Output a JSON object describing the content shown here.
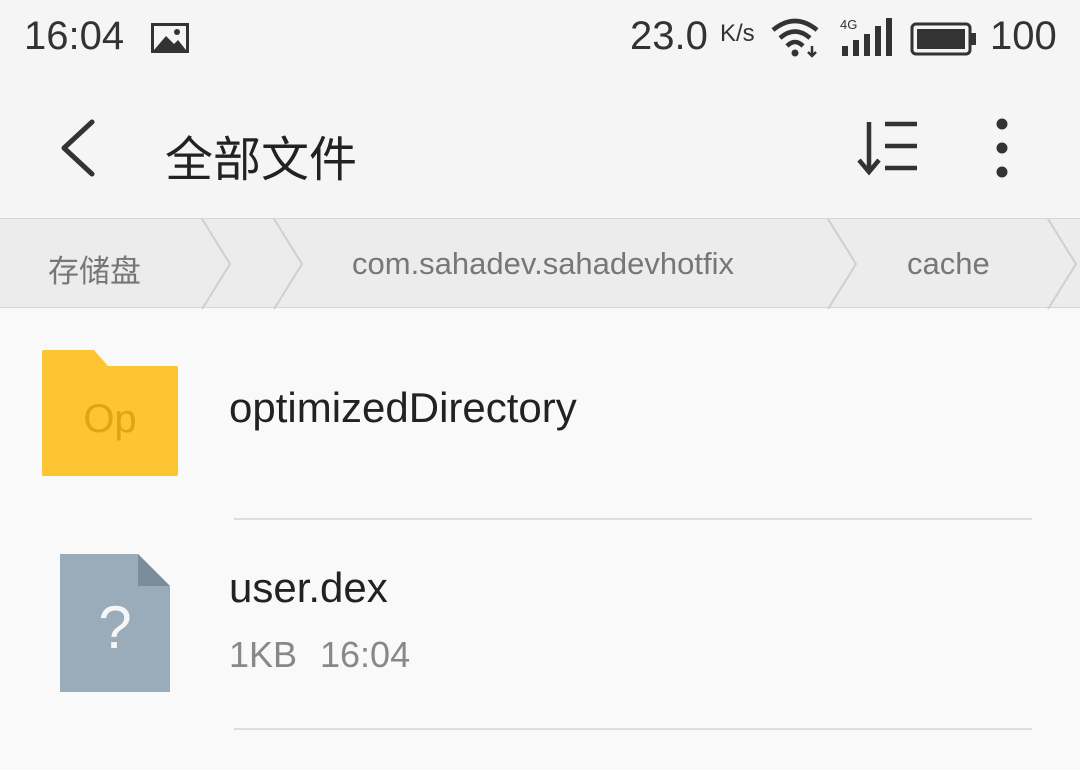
{
  "status_bar": {
    "time": "16:04",
    "notification_icon": "photo-icon",
    "net_speed": "23.0",
    "net_speed_unit": "K/s",
    "wifi_icon": "wifi-icon",
    "signal_label": "4G",
    "battery_level": "100"
  },
  "toolbar": {
    "title": "全部文件",
    "back_icon": "chevron-left-icon",
    "sort_icon": "sort-icon",
    "more_icon": "more-vertical-icon"
  },
  "breadcrumb": {
    "items": [
      "存储盘",
      "com.sahadev.sahadevhotfix",
      "cache"
    ]
  },
  "files": [
    {
      "name": "optimizedDirectory",
      "type": "folder",
      "icon_text": "Op",
      "meta": ""
    },
    {
      "name": "user.dex",
      "type": "file",
      "icon_text": "?",
      "size": "1KB",
      "modified": "16:04"
    }
  ],
  "colors": {
    "folder": "#fcc531",
    "folder_tab": "#f5b823",
    "folder_text": "#e0a414",
    "file": "#9aabb9",
    "file_corner": "#7c8c99"
  }
}
